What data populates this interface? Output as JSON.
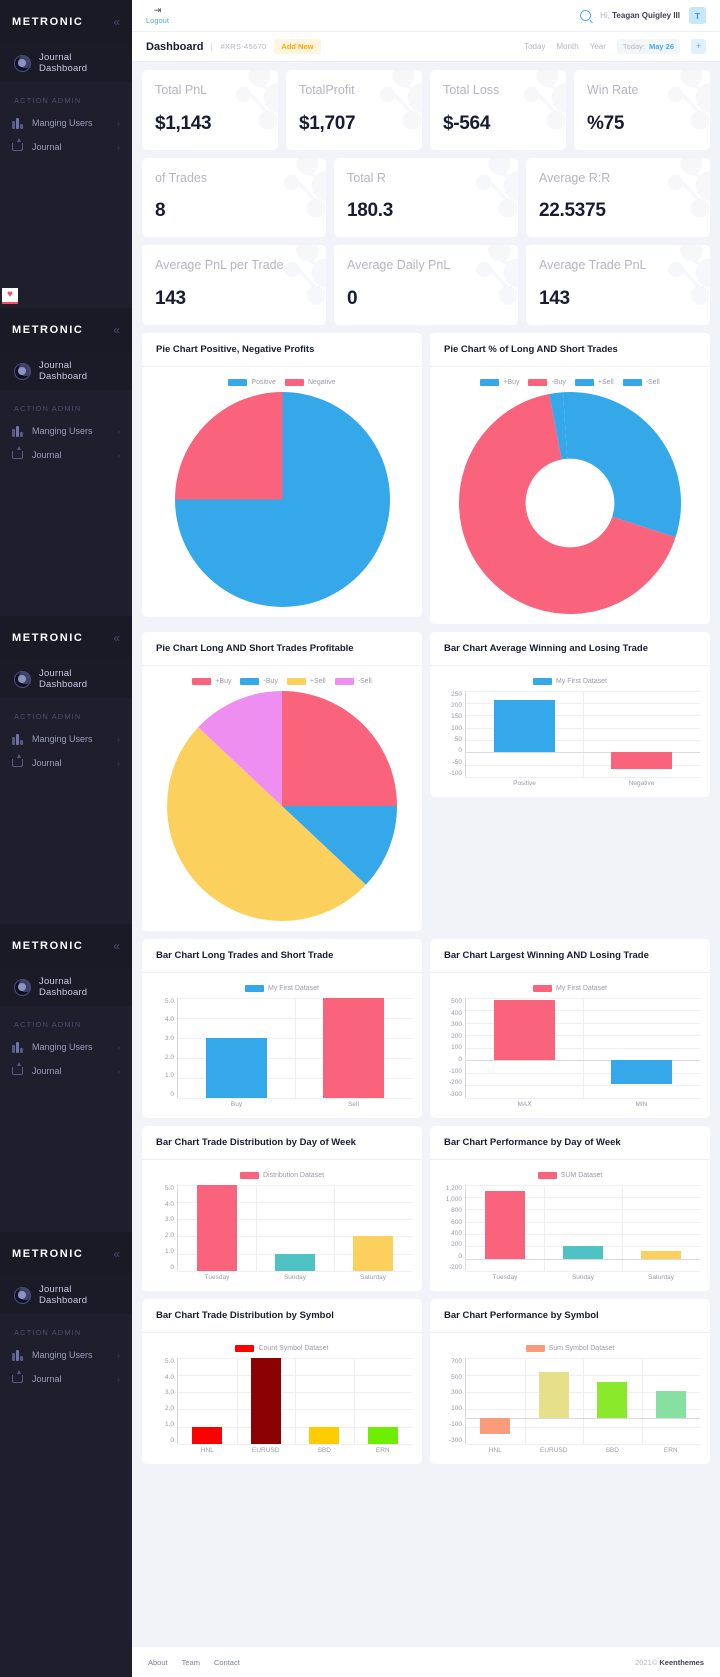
{
  "sidebar": {
    "brand": "METRONIC",
    "collapse_icon": "chevron-double-left",
    "dashboard_label": "Journal Dashboard",
    "section_label": "ACTION ADMIN",
    "items": [
      {
        "label": "Manging Users",
        "icon": "bars-icon",
        "arrow": "›"
      },
      {
        "label": "Journal",
        "icon": "upload-box-icon",
        "arrow": "›"
      }
    ],
    "repeat_count": 5,
    "glyph": "♥"
  },
  "topbar": {
    "logout_label": "Logout",
    "logout_icon": "logout-icon",
    "search_icon": "search-icon",
    "greeting_prefix": "Hi,",
    "user_name": "Teagan Quigley III",
    "avatar_initial": "T"
  },
  "subbar": {
    "title": "Dashboard",
    "record_id": "#XRS-45670",
    "add_new_label": "Add New",
    "filters": [
      "Today",
      "Month",
      "Year"
    ],
    "today_label": "Today:",
    "today_value": "May 26",
    "plus_label": "+"
  },
  "stats": [
    [
      {
        "label": "Total PnL",
        "value": "$1,143"
      },
      {
        "label": "TotalProfit",
        "value": "$1,707"
      },
      {
        "label": "Total Loss",
        "value": "$-564"
      },
      {
        "label": "Win Rate",
        "value": "%75"
      }
    ],
    [
      {
        "label": "of Trades",
        "value": "8"
      },
      {
        "label": "Total R",
        "value": "180.3"
      },
      {
        "label": "Average R:R",
        "value": "22.5375"
      }
    ],
    [
      {
        "label": "Average PnL per Trade",
        "value": "143"
      },
      {
        "label": "Average Daily PnL",
        "value": "0"
      },
      {
        "label": "Average Trade PnL",
        "value": "143"
      }
    ]
  ],
  "colors": {
    "blue": "#34a8e8",
    "pink": "#f9637c",
    "yellow": "#fbd05d",
    "magenta": "#ee8ef0",
    "teal": "#4fc3c3",
    "orange": "#fa9b7c",
    "khaki": "#e6e08a",
    "lime": "#8ae92b",
    "green": "#87e0a0",
    "red": "#fd0000",
    "darkred": "#8b0000",
    "gold": "#ffcc00",
    "accent": "#4aa9f2"
  },
  "chart_data": [
    {
      "id": "pie-positive-negative",
      "type": "pie",
      "title": "Pie Chart Positive, Negative Profits",
      "legend": [
        "Positive",
        "Negative"
      ],
      "legend_position": "top",
      "categories": [
        "Positive",
        "Negative"
      ],
      "values": [
        75,
        25
      ],
      "colors": [
        "#34a8e8",
        "#f9637c"
      ]
    },
    {
      "id": "donut-long-short",
      "type": "pie",
      "variant": "doughnut",
      "title": "Pie Chart % of Long AND Short Trades",
      "legend": [
        "+Buy",
        "-Buy",
        "+Sell",
        "-Sell"
      ],
      "legend_position": "top",
      "categories": [
        "+Buy",
        "-Buy",
        "+Sell",
        "-Sell"
      ],
      "values": [
        30,
        67,
        2,
        1
      ],
      "colors": [
        "#34a8e8",
        "#f9637c",
        "#34a8e8",
        "#34a8e8"
      ]
    },
    {
      "id": "pie-long-short-profitable",
      "type": "pie",
      "title": "Pie Chart Long AND Short Trades Profitable",
      "legend": [
        "+Buy",
        "-Buy",
        "+Sell",
        "-Sell"
      ],
      "legend_position": "top",
      "categories": [
        "+Buy",
        "-Buy",
        "+Sell",
        "-Sell"
      ],
      "values": [
        25,
        12,
        50,
        13
      ],
      "colors": [
        "#f9637c",
        "#34a8e8",
        "#fbd05d",
        "#ee8ef0"
      ]
    },
    {
      "id": "bar-avg-win-lose",
      "type": "bar",
      "title": "Bar Chart Average Winning and Losing Trade",
      "legend": [
        "My First Dataset"
      ],
      "legend_position": "top",
      "categories": [
        "Positive",
        "Negative"
      ],
      "values": [
        212,
        -70
      ],
      "bar_colors": [
        "#34a8e8",
        "#f9637c"
      ],
      "yticks": [
        250,
        200,
        150,
        100,
        50,
        0,
        -50,
        -100
      ],
      "ylim": [
        -100,
        250
      ]
    },
    {
      "id": "bar-long-short-trades",
      "type": "bar",
      "title": "Bar Chart Long Trades and Short Trade",
      "legend": [
        "My First Dataset"
      ],
      "legend_position": "top",
      "categories": [
        "Buy",
        "Sell"
      ],
      "values": [
        3.0,
        5.0
      ],
      "bar_colors": [
        "#34a8e8",
        "#f9637c"
      ],
      "yticks": [
        "5.0",
        "4.0",
        "3.0",
        "2.0",
        "1.0",
        "0"
      ],
      "ylim": [
        0,
        5
      ]
    },
    {
      "id": "bar-largest-win-lose",
      "type": "bar",
      "title": "Bar Chart Largest Winning AND Losing Trade",
      "legend": [
        "My First Dataset"
      ],
      "legend_position": "top",
      "categories": [
        "MAX",
        "MIN"
      ],
      "values": [
        480,
        -185
      ],
      "bar_colors": [
        "#f9637c",
        "#34a8e8"
      ],
      "yticks": [
        500,
        400,
        300,
        200,
        100,
        0,
        -100,
        -200,
        -300
      ],
      "ylim": [
        -300,
        500
      ]
    },
    {
      "id": "bar-trade-dist-day",
      "type": "bar",
      "title": "Bar Chart Trade Distribution by Day of Week",
      "legend": [
        "Distribution Dataset"
      ],
      "legend_position": "top",
      "categories": [
        "Tuesday",
        "Sunday",
        "Saturday"
      ],
      "values": [
        5.0,
        1.0,
        2.0
      ],
      "bar_colors": [
        "#f9637c",
        "#4fc3c3",
        "#fbd05d"
      ],
      "yticks": [
        "5.0",
        "4.0",
        "3.0",
        "2.0",
        "1.0",
        "0"
      ],
      "ylim": [
        0,
        5
      ]
    },
    {
      "id": "bar-performance-day",
      "type": "bar",
      "title": "Bar Chart Performance by Day of Week",
      "legend": [
        "SUM Dataset"
      ],
      "legend_position": "top",
      "categories": [
        "Tuesday",
        "Sunday",
        "Saturday"
      ],
      "values": [
        1100,
        200,
        120
      ],
      "bar_colors": [
        "#f9637c",
        "#4fc3c3",
        "#fbd05d"
      ],
      "yticks": [
        "1,200",
        "1,000",
        "800",
        "600",
        "400",
        "200",
        "0",
        "-200"
      ],
      "ylim": [
        -200,
        1200
      ]
    },
    {
      "id": "bar-trade-dist-symbol",
      "type": "bar",
      "title": "Bar Chart Trade Distribution by Symbol",
      "legend": [
        "Count Symbol Dataset"
      ],
      "legend_position": "top",
      "categories": [
        "HNL",
        "EURUSD",
        "SBD",
        "ERN"
      ],
      "values": [
        1.0,
        5.0,
        1.0,
        1.0
      ],
      "bar_colors": [
        "#fd0000",
        "#8b0000",
        "#ffcc00",
        "#6eee00"
      ],
      "yticks": [
        "5.0",
        "4.0",
        "3.0",
        "2.0",
        "1.0",
        "0"
      ],
      "ylim": [
        0,
        5
      ]
    },
    {
      "id": "bar-performance-symbol",
      "type": "bar",
      "title": "Bar Chart Performance by Symbol",
      "legend": [
        "Sum Symbol Dataset"
      ],
      "legend_position": "top",
      "categories": [
        "HNL",
        "EURUSD",
        "SBD",
        "ERN"
      ],
      "values": [
        -190,
        530,
        420,
        320
      ],
      "bar_colors": [
        "#fa9b7c",
        "#e6e08a",
        "#8ae92b",
        "#87e0a0"
      ],
      "yticks": [
        700,
        500,
        300,
        100,
        "-100",
        "-300"
      ],
      "ylim": [
        -300,
        700
      ]
    }
  ],
  "footer": {
    "links": [
      "About",
      "Team",
      "Contact"
    ],
    "year": "2021©",
    "brand": "Keenthemes"
  }
}
